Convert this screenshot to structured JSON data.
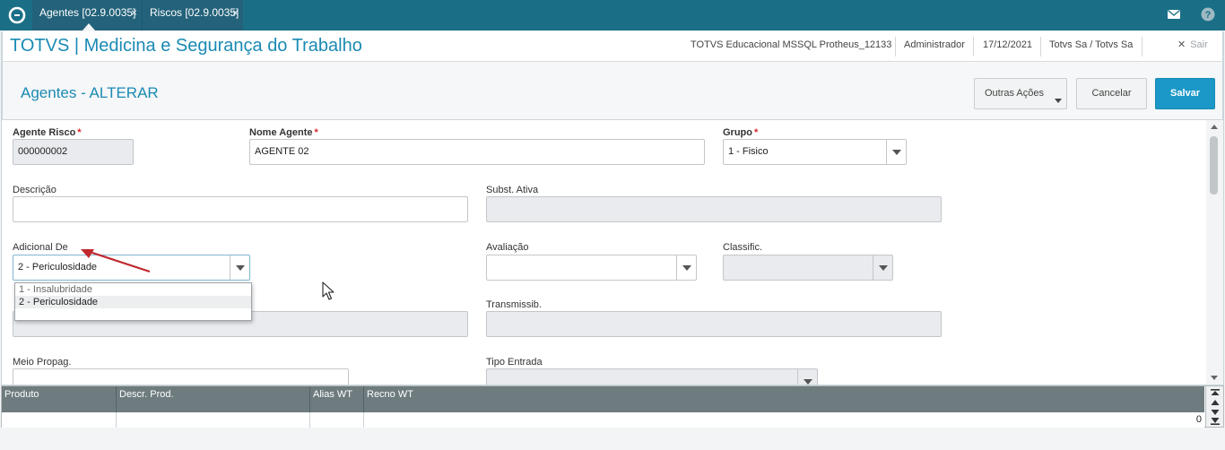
{
  "tabs": [
    {
      "label": "Agentes [02.9.0035]",
      "close": "×"
    },
    {
      "label": "Riscos [02.9.0035]",
      "close": "×"
    }
  ],
  "header": {
    "title": "TOTVS | Medicina e Segurança do Trabalho",
    "environment": "TOTVS Educacional MSSQL Protheus_12133",
    "user": "Administrador",
    "date": "17/12/2021",
    "company": "Totvs Sa / Totvs Sa",
    "logout_label": "Sair"
  },
  "page": {
    "title": "Agentes - ALTERAR",
    "other_actions_label": "Outras Ações",
    "cancel_label": "Cancelar",
    "save_label": "Salvar"
  },
  "form": {
    "agente_risco": {
      "label": "Agente Risco",
      "value": "000000002"
    },
    "nome_agente": {
      "label": "Nome Agente",
      "value": "AGENTE 02"
    },
    "grupo": {
      "label": "Grupo",
      "value": "1 - Fisico"
    },
    "descricao": {
      "label": "Descrição",
      "value": ""
    },
    "subst_ativa": {
      "label": "Subst. Ativa",
      "value": ""
    },
    "adicional_de": {
      "label": "Adicional De",
      "value": "2 - Periculosidade",
      "options": [
        "1 - Insalubridade",
        "2 - Periculosidade"
      ]
    },
    "avaliacao": {
      "label": "Avaliação",
      "value": ""
    },
    "classific": {
      "label": "Classific.",
      "value": ""
    },
    "transmissib": {
      "label": "Transmissib.",
      "value": ""
    },
    "meio_propag": {
      "label": "Meio Propag.",
      "value": ""
    },
    "tipo_entrada": {
      "label": "Tipo Entrada",
      "value": ""
    },
    "required_mark": "*"
  },
  "grid": {
    "columns": [
      "Produto",
      "Descr. Prod.",
      "Alias WT",
      "Recno WT"
    ],
    "row": [
      "",
      "",
      "",
      ""
    ],
    "count": "0"
  },
  "colors": {
    "topbar": "#1a6f87",
    "accent": "#1b8ab3",
    "primary_button": "#1b98c7",
    "required": "#d9232e",
    "grid_header": "#6e7c7f",
    "annotation_arrow": "#c0282e"
  }
}
